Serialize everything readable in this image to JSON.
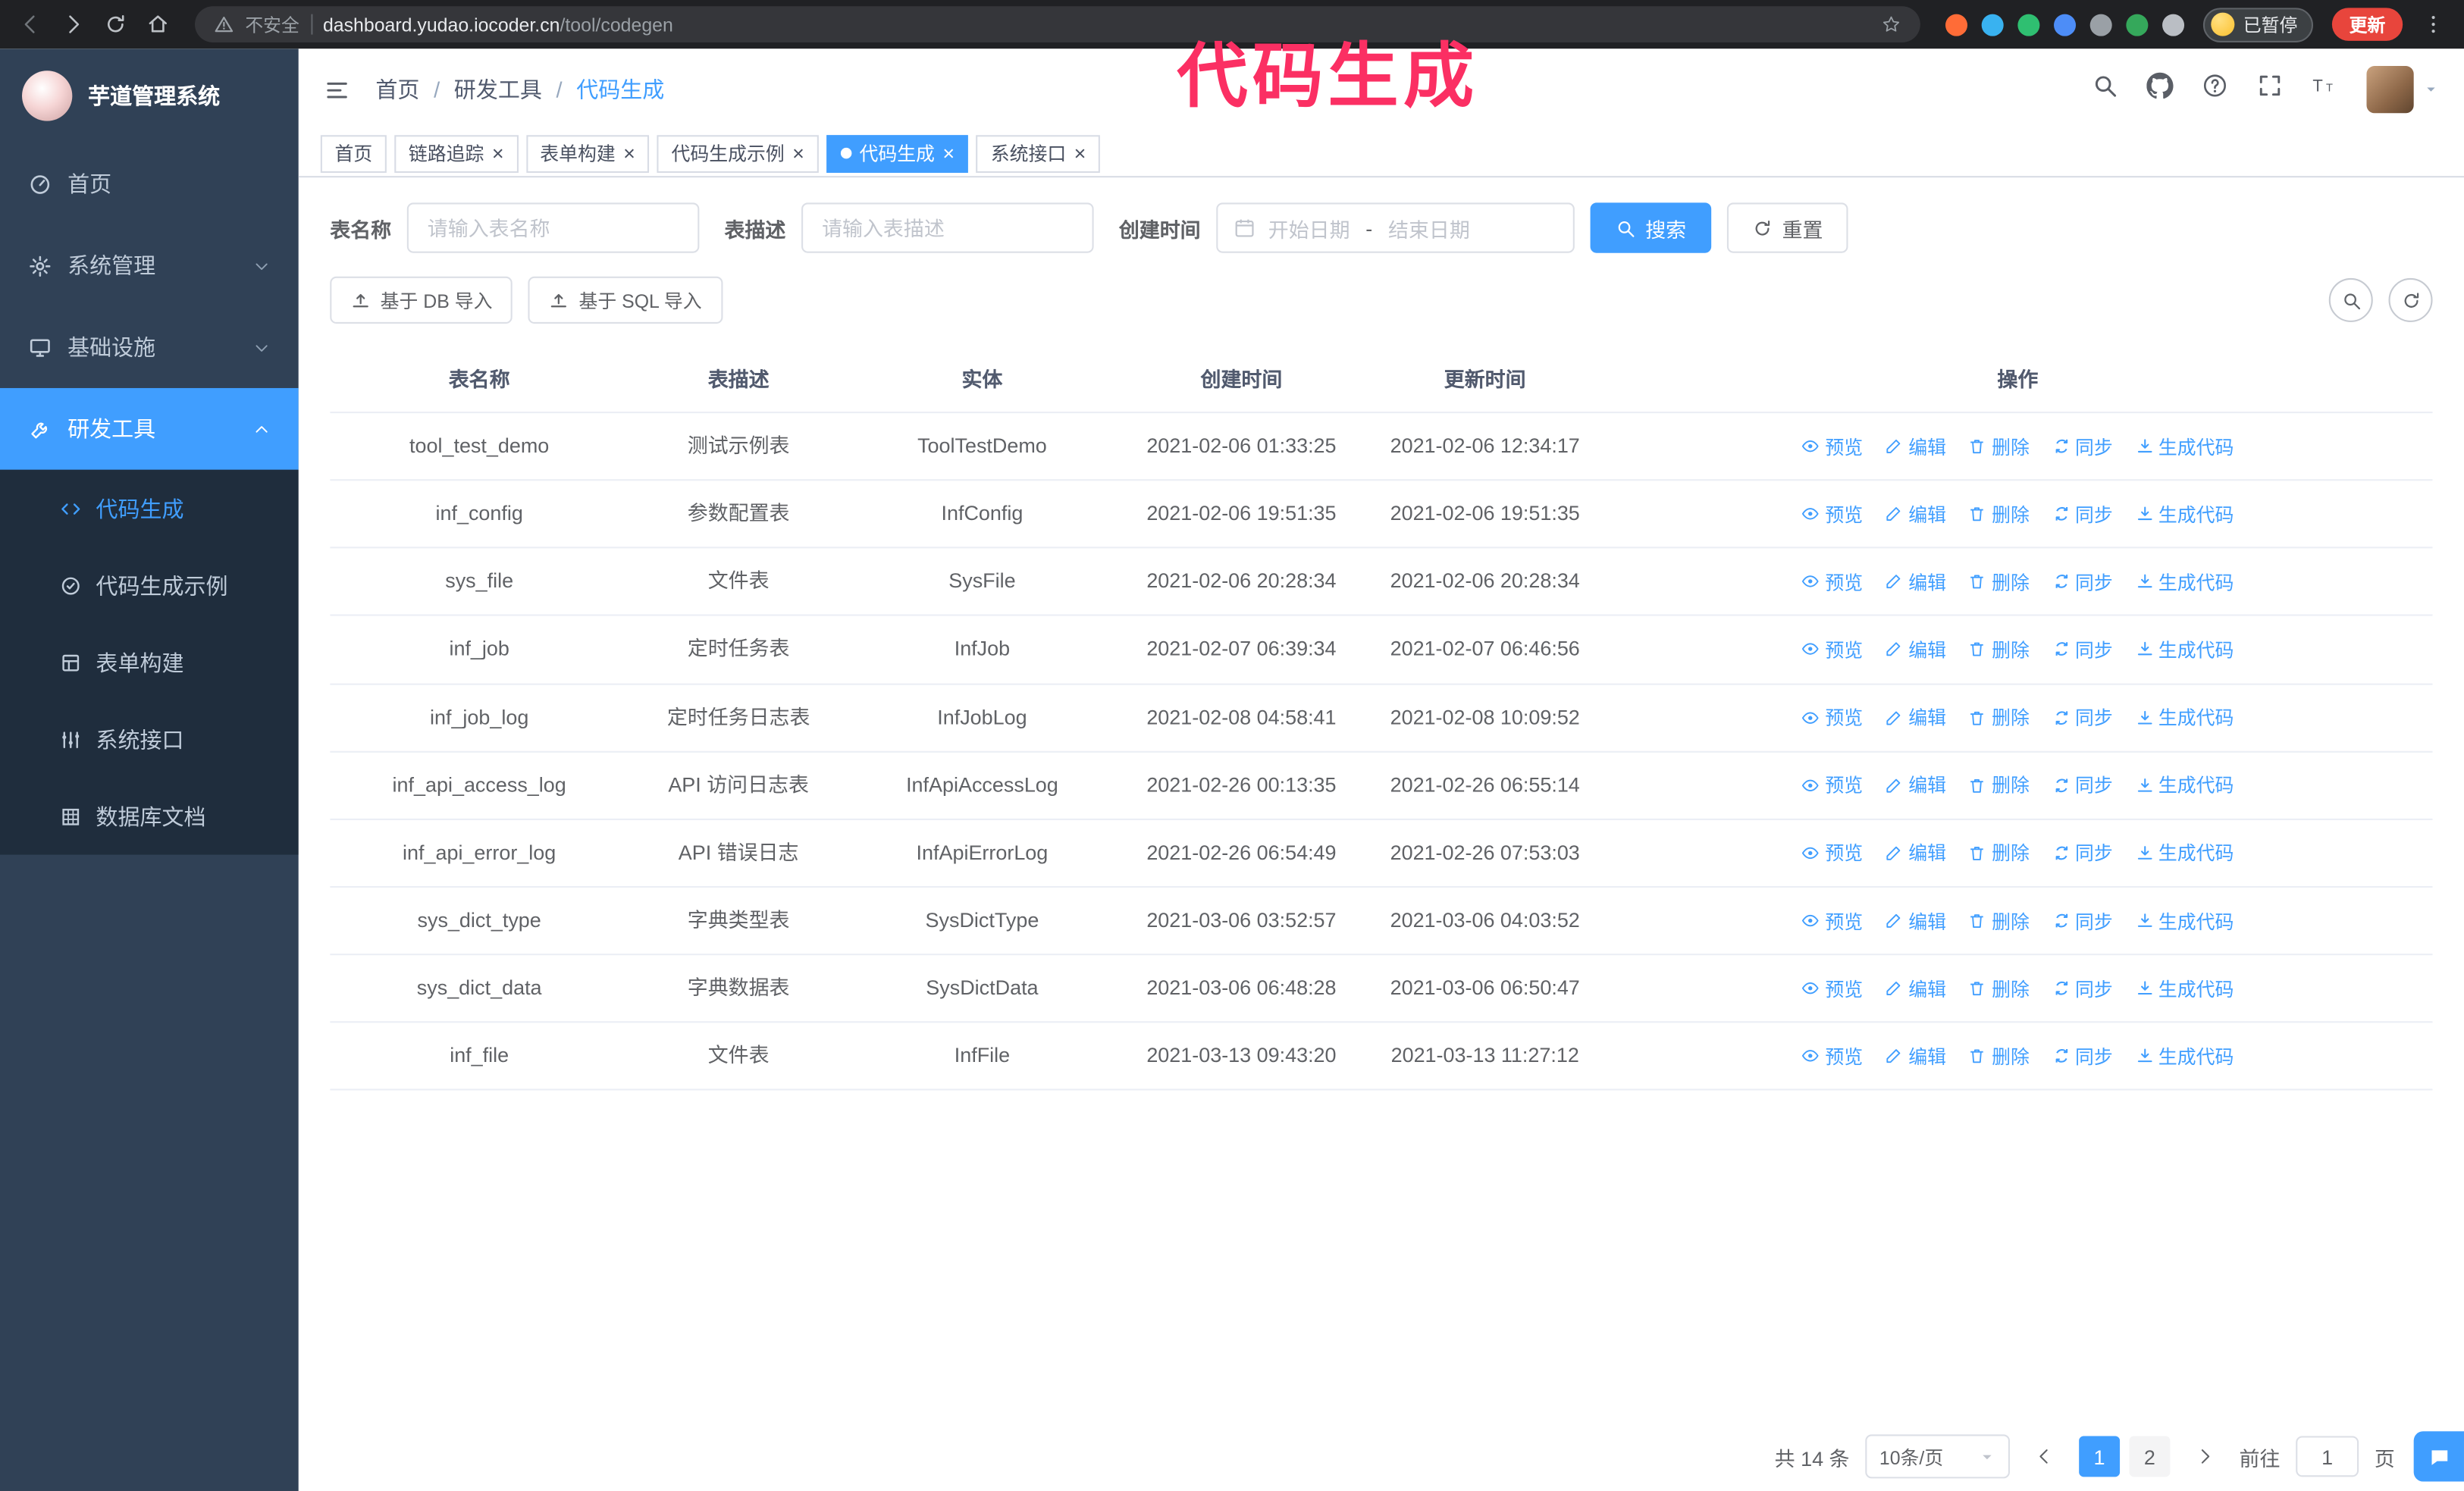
{
  "annotation": {
    "text": "代码生成",
    "color": "#fb2f63"
  },
  "browser": {
    "security_label": "不安全",
    "url_host": "dashboard.yudao.iocoder.cn",
    "url_path": "/tool/codegen",
    "paused_badge": "已暂停",
    "update_button": "更新",
    "nav_icons": [
      "back-icon",
      "forward-icon",
      "refresh-icon",
      "home-icon"
    ],
    "extensions": [
      {
        "name": "postman-extension-icon",
        "color": "#ff6c37"
      },
      {
        "name": "water-drop-extension-icon",
        "color": "#39b2f0"
      },
      {
        "name": "vue-devtools-extension-icon",
        "color": "#2fbf71"
      },
      {
        "name": "people-extension-icon",
        "color": "#4d8df7"
      },
      {
        "name": "screen-extension-icon",
        "color": "#9aa0a6"
      },
      {
        "name": "leaf-extension-icon",
        "color": "#35a85b"
      },
      {
        "name": "puzzle-extension-icon",
        "color": "#babec4"
      }
    ]
  },
  "sidebar": {
    "logo_title": "芋道管理系统",
    "items": [
      {
        "key": "home",
        "label": "首页",
        "icon": "dashboard-icon",
        "expandable": false,
        "active": false,
        "expanded": false
      },
      {
        "key": "system",
        "label": "系统管理",
        "icon": "gear-icon",
        "expandable": true,
        "active": false,
        "expanded": false
      },
      {
        "key": "infra",
        "label": "基础设施",
        "icon": "monitor-icon",
        "expandable": true,
        "active": false,
        "expanded": false
      },
      {
        "key": "devtools",
        "label": "研发工具",
        "icon": "tool-icon",
        "expandable": true,
        "active": true,
        "expanded": true
      }
    ],
    "subitems": [
      {
        "key": "codegen",
        "label": "代码生成",
        "icon": "code-icon",
        "active": true
      },
      {
        "key": "codegen-example",
        "label": "代码生成示例",
        "icon": "badge-check-icon",
        "active": false
      },
      {
        "key": "form-builder",
        "label": "表单构建",
        "icon": "form-icon",
        "active": false
      },
      {
        "key": "api",
        "label": "系统接口",
        "icon": "api-icon",
        "active": false
      },
      {
        "key": "db-doc",
        "label": "数据库文档",
        "icon": "database-icon",
        "active": false
      }
    ]
  },
  "navbar": {
    "breadcrumb": [
      {
        "label": "首页"
      },
      {
        "label": "研发工具"
      },
      {
        "label": "代码生成"
      }
    ],
    "tools": [
      "search-icon",
      "github-icon",
      "question-icon",
      "fullscreen-icon",
      "font-size-icon"
    ]
  },
  "tabs": [
    {
      "key": "home",
      "label": "首页",
      "closable": false,
      "active": false
    },
    {
      "key": "tracer",
      "label": "链路追踪",
      "closable": true,
      "active": false
    },
    {
      "key": "form-builder",
      "label": "表单构建",
      "closable": true,
      "active": false
    },
    {
      "key": "codegen-example",
      "label": "代码生成示例",
      "closable": true,
      "active": false
    },
    {
      "key": "codegen",
      "label": "代码生成",
      "closable": true,
      "active": true
    },
    {
      "key": "api",
      "label": "系统接口",
      "closable": true,
      "active": false
    }
  ],
  "filters": {
    "name_label": "表名称",
    "name_placeholder": "请输入表名称",
    "desc_label": "表描述",
    "desc_placeholder": "请输入表描述",
    "time_label": "创建时间",
    "date_start": "开始日期",
    "date_sep": "-",
    "date_end": "结束日期",
    "search_button": "搜索",
    "reset_button": "重置"
  },
  "toolbar": {
    "import_db_button": "基于 DB 导入",
    "import_sql_button": "基于 SQL 导入"
  },
  "table": {
    "columns": [
      "表名称",
      "表描述",
      "实体",
      "创建时间",
      "更新时间",
      "操作"
    ],
    "actions": [
      {
        "key": "preview",
        "label": "预览",
        "icon": "eye-icon"
      },
      {
        "key": "edit",
        "label": "编辑",
        "icon": "edit-icon"
      },
      {
        "key": "delete",
        "label": "删除",
        "icon": "trash-icon"
      },
      {
        "key": "sync",
        "label": "同步",
        "icon": "sync-icon"
      },
      {
        "key": "generate",
        "label": "生成代码",
        "icon": "download-icon"
      }
    ],
    "rows": [
      {
        "name": "tool_test_demo",
        "desc": "测试示例表",
        "entity": "ToolTestDemo",
        "created": "2021-02-06 01:33:25",
        "updated": "2021-02-06 12:34:17"
      },
      {
        "name": "inf_config",
        "desc": "参数配置表",
        "entity": "InfConfig",
        "created": "2021-02-06 19:51:35",
        "updated": "2021-02-06 19:51:35"
      },
      {
        "name": "sys_file",
        "desc": "文件表",
        "entity": "SysFile",
        "created": "2021-02-06 20:28:34",
        "updated": "2021-02-06 20:28:34"
      },
      {
        "name": "inf_job",
        "desc": "定时任务表",
        "entity": "InfJob",
        "created": "2021-02-07 06:39:34",
        "updated": "2021-02-07 06:46:56"
      },
      {
        "name": "inf_job_log",
        "desc": "定时任务日志表",
        "entity": "InfJobLog",
        "created": "2021-02-08 04:58:41",
        "updated": "2021-02-08 10:09:52"
      },
      {
        "name": "inf_api_access_log",
        "desc": "API 访问日志表",
        "entity": "InfApiAccessLog",
        "created": "2021-02-26 00:13:35",
        "updated": "2021-02-26 06:55:14"
      },
      {
        "name": "inf_api_error_log",
        "desc": "API 错误日志",
        "entity": "InfApiErrorLog",
        "created": "2021-02-26 06:54:49",
        "updated": "2021-02-26 07:53:03"
      },
      {
        "name": "sys_dict_type",
        "desc": "字典类型表",
        "entity": "SysDictType",
        "created": "2021-03-06 03:52:57",
        "updated": "2021-03-06 04:03:52"
      },
      {
        "name": "sys_dict_data",
        "desc": "字典数据表",
        "entity": "SysDictData",
        "created": "2021-03-06 06:48:28",
        "updated": "2021-03-06 06:50:47"
      },
      {
        "name": "inf_file",
        "desc": "文件表",
        "entity": "InfFile",
        "created": "2021-03-13 09:43:20",
        "updated": "2021-03-13 11:27:12"
      }
    ]
  },
  "pagination": {
    "total_text": "共 14 条",
    "page_size": "10条/页",
    "pages": [
      "1",
      "2"
    ],
    "active_page": "1",
    "goto_label": "前往",
    "goto_value": "1",
    "goto_suffix": "页"
  },
  "colors": {
    "accent": "#409eff",
    "sidebar_bg": "#304156",
    "submenu_bg": "#1f2d3d"
  }
}
